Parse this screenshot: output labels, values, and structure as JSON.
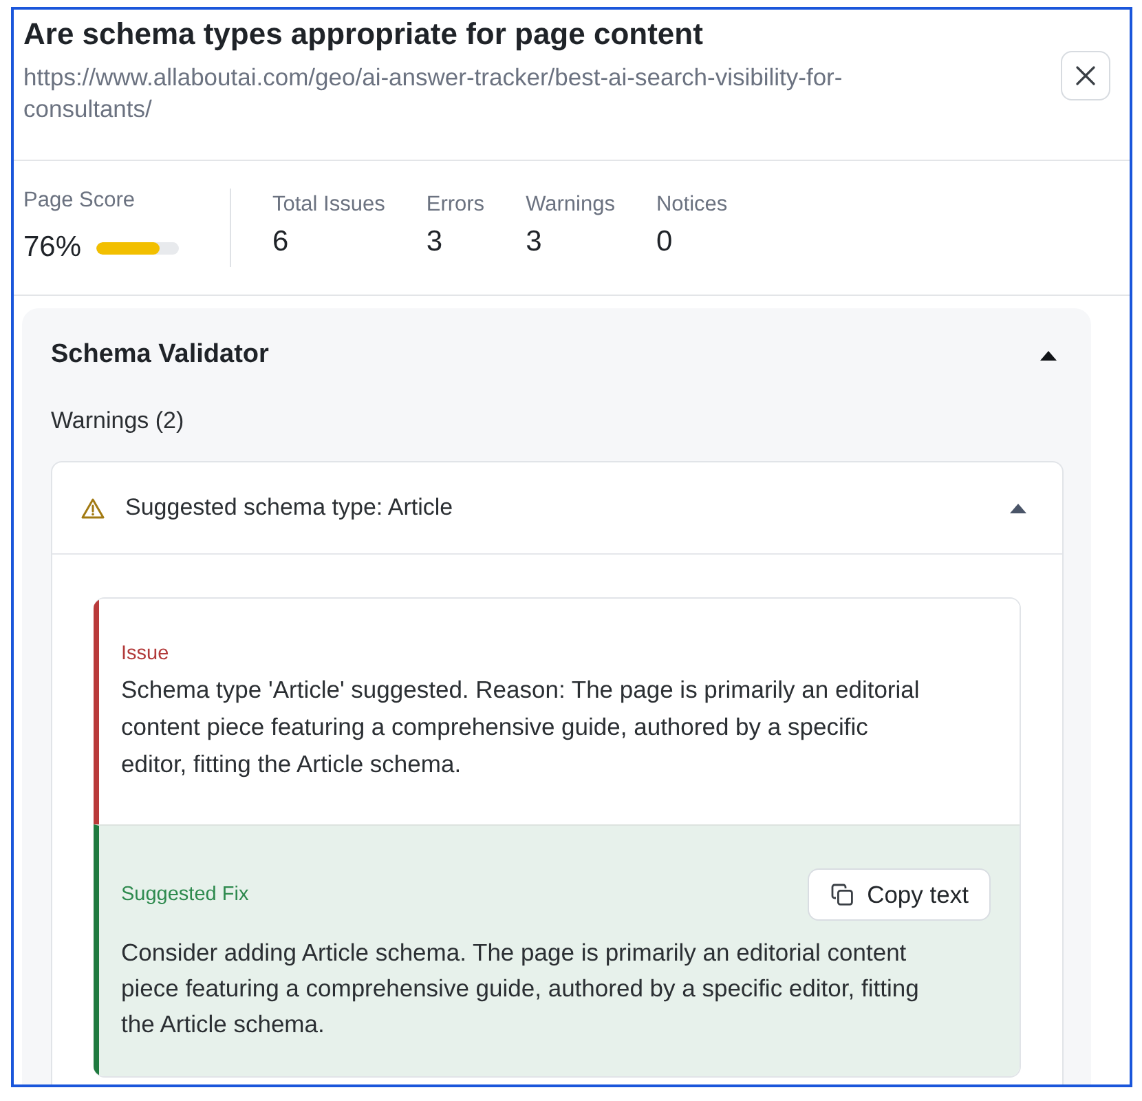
{
  "panel": {
    "title": "Are schema types appropriate for page content",
    "url": "https://www.allaboutai.com/geo/ai-answer-tracker/best-ai-search-visibility-for-consultants/"
  },
  "stats": {
    "page_score": {
      "label": "Page Score",
      "value": "76%",
      "level": 0.76
    },
    "counts": [
      {
        "label": "Total Issues",
        "value": "6"
      },
      {
        "label": "Errors",
        "value": "3"
      },
      {
        "label": "Warnings",
        "value": "3"
      },
      {
        "label": "Notices",
        "value": "0"
      }
    ]
  },
  "schema_validator": {
    "title": "Schema Validator",
    "expanded": true,
    "warnings_heading": "Warnings (2)",
    "warnings": [
      {
        "title": "Suggested schema type: Article",
        "expanded": true,
        "issue": {
          "label": "Issue",
          "text": "Schema type 'Article' suggested. Reason: The page is primarily an editorial content piece featuring a comprehensive guide, authored by a specific editor, fitting the Article schema."
        },
        "fix": {
          "label": "Suggested Fix",
          "text": "Consider adding Article schema. The page is primarily an editorial content piece featuring a comprehensive guide, authored by a specific editor, fitting the Article schema.",
          "copy_button": "Copy text"
        }
      }
    ]
  }
}
